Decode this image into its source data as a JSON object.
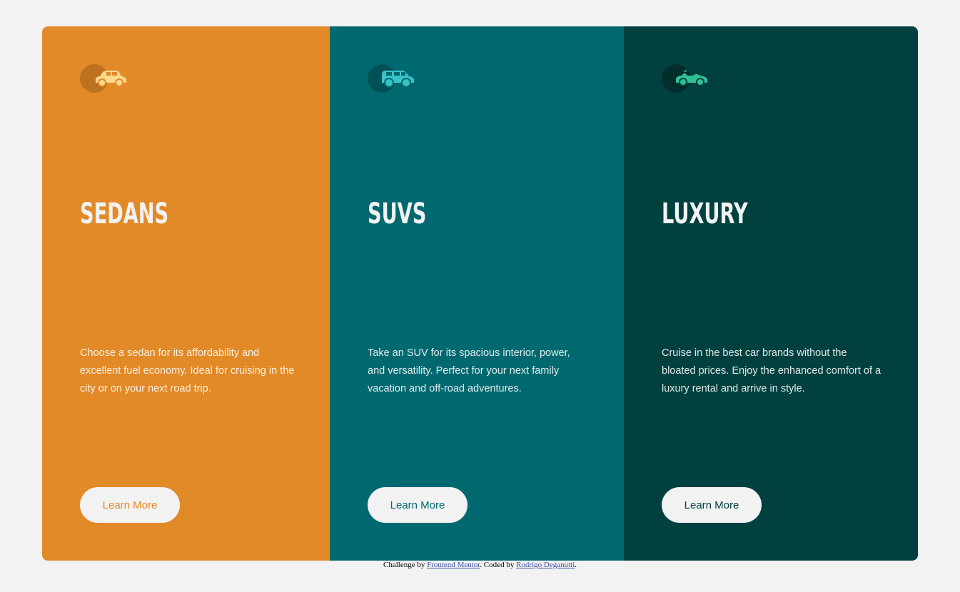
{
  "colors": {
    "page_background": "#f2f2f2",
    "sedans": "#e28a27",
    "suvs": "#006970",
    "luxury": "#004140",
    "button_background": "#f2f2f2"
  },
  "cards": [
    {
      "icon": "sedan-car-icon",
      "title": "SEDANS",
      "description": "Choose a sedan for its affordability and excellent fuel economy. Ideal for cruising in the city or on your next road trip.",
      "button_label": "Learn More"
    },
    {
      "icon": "suv-car-icon",
      "title": "SUVS",
      "description": "Take an SUV for its spacious interior, power, and versatility. Perfect for your next family vacation and off-road adventures.",
      "button_label": "Learn More"
    },
    {
      "icon": "luxury-car-icon",
      "title": "LUXURY",
      "description": "Cruise in the best car brands without the bloated prices. Enjoy the enhanced comfort of a luxury rental and arrive in style.",
      "button_label": "Learn More"
    }
  ],
  "footer": {
    "prefix": "Challenge by ",
    "link1": "Frontend Mentor",
    "middle": ". Coded by ",
    "link2": "Rodrigo Deganutti",
    "suffix": "."
  }
}
